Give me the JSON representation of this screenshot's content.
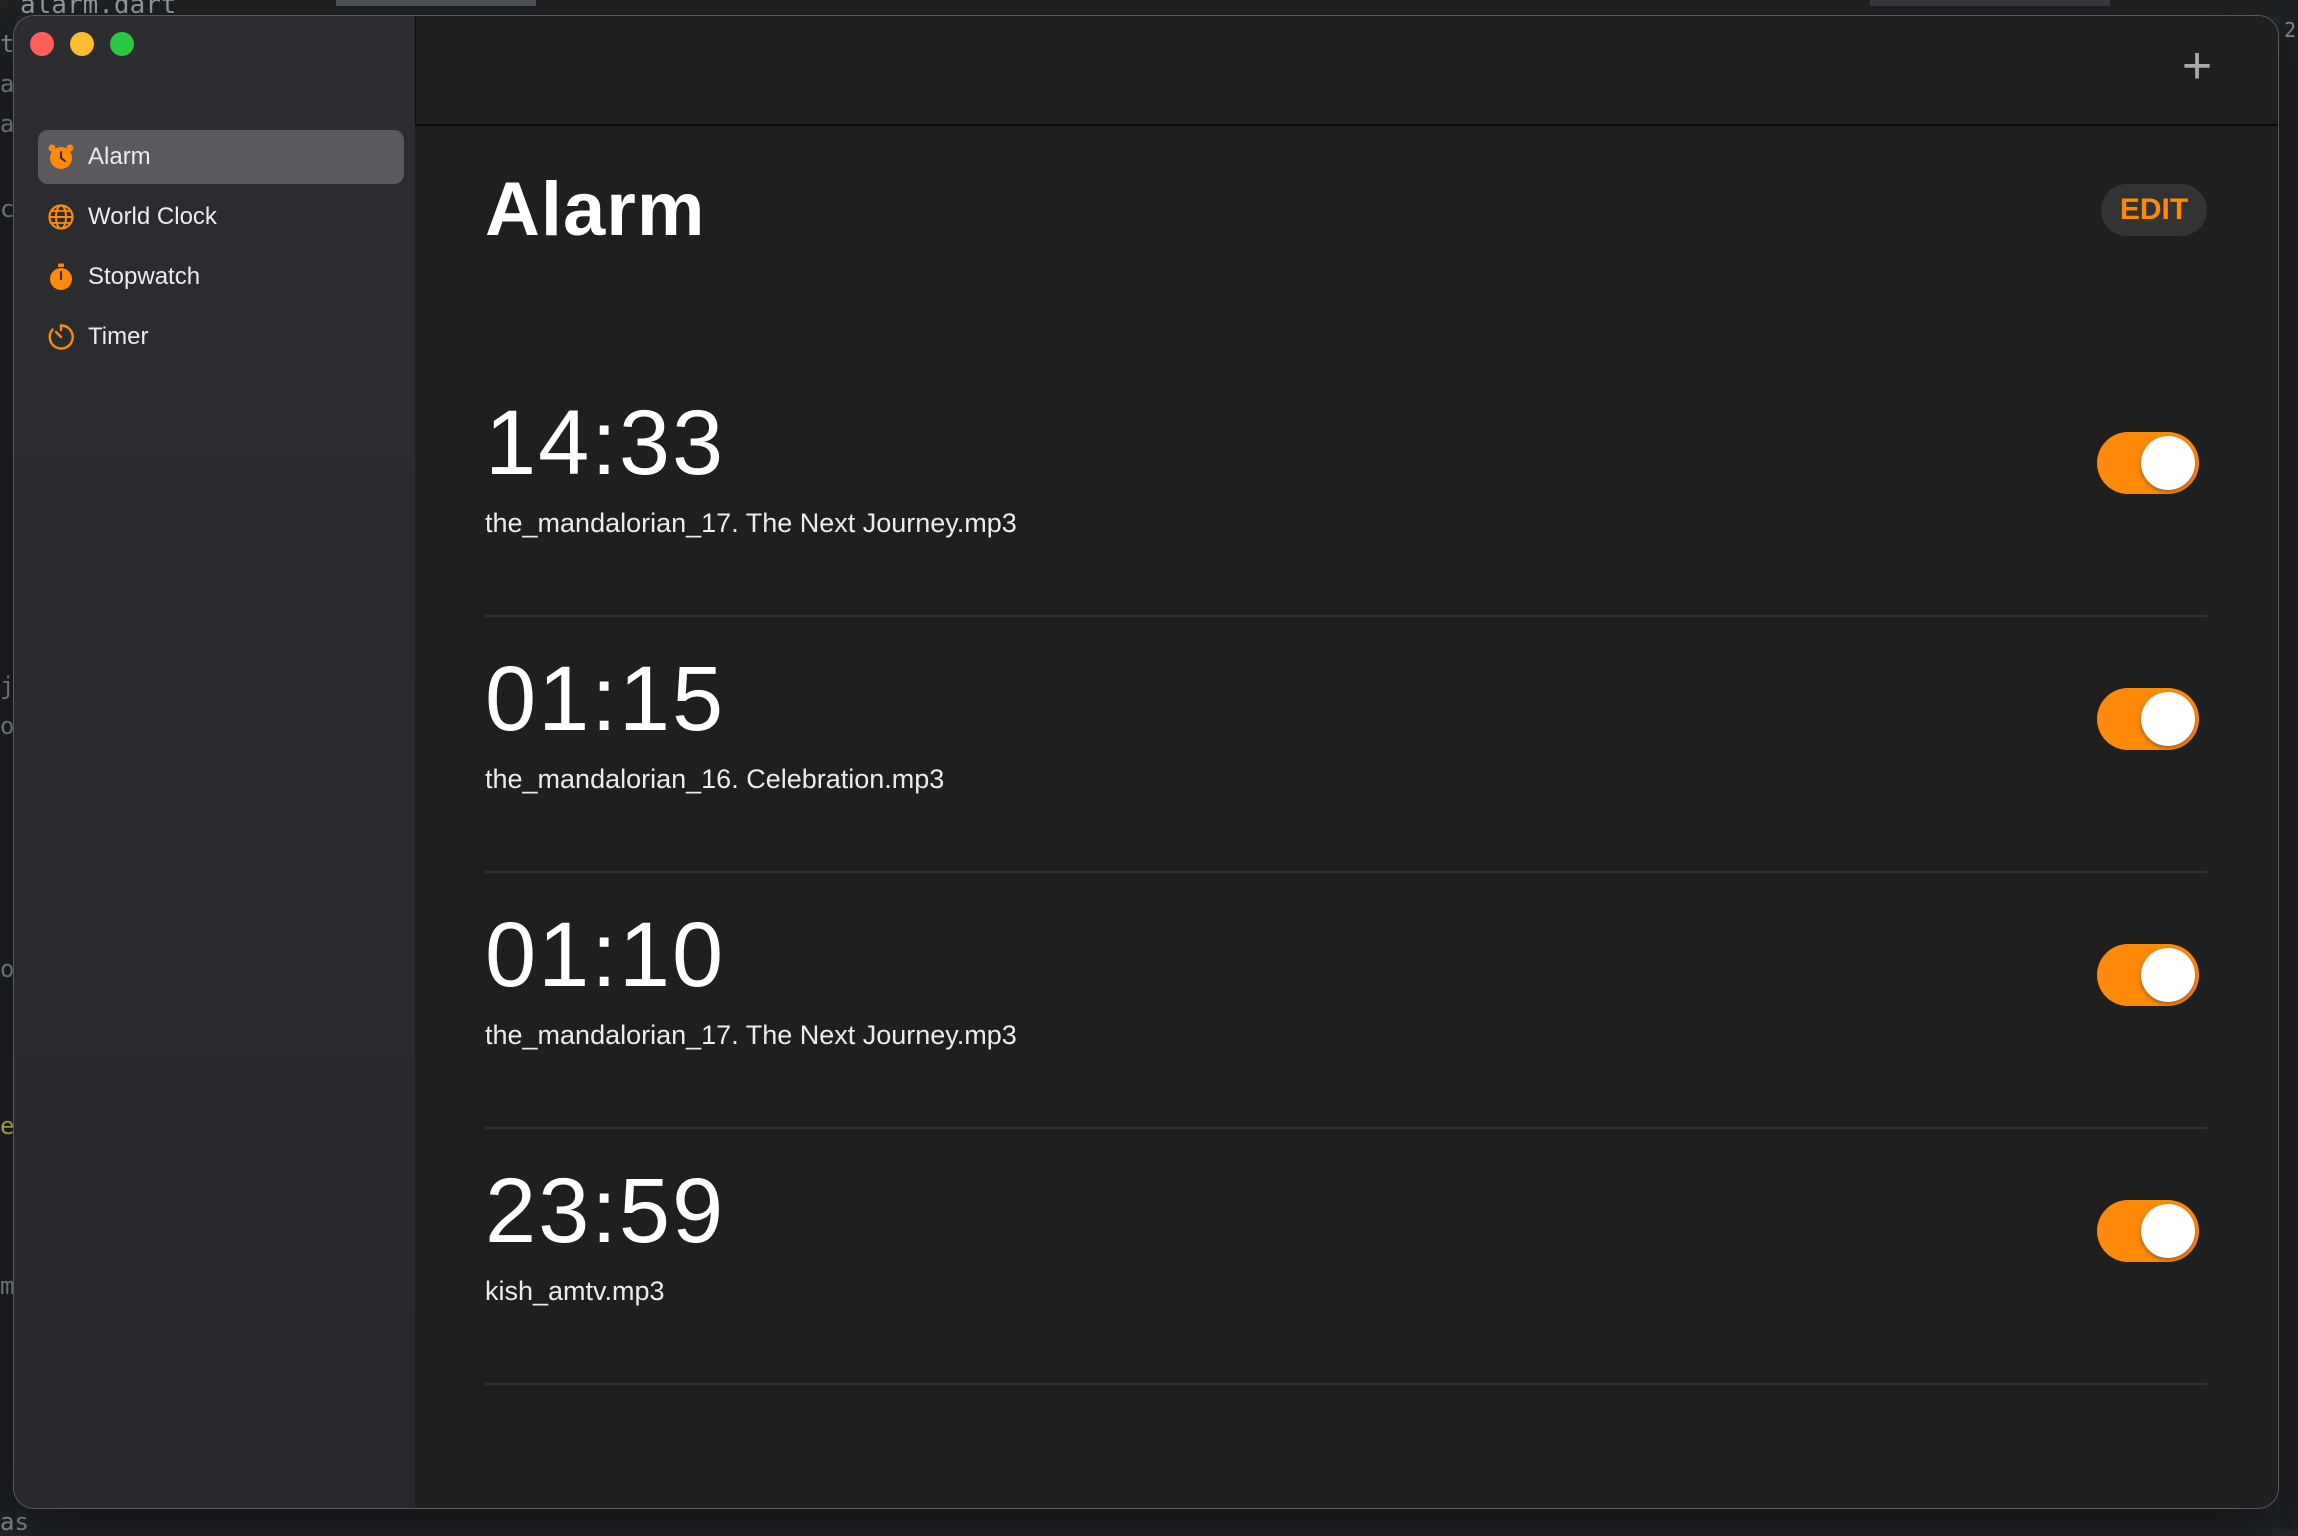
{
  "background_editor": {
    "title_fragment": "alarm.dart",
    "glyphs": [
      "t.",
      "at",
      "at",
      "c",
      "j",
      "oa",
      "or",
      "e",
      "m",
      "as"
    ],
    "right_number": "2"
  },
  "window": {
    "controls": [
      "close",
      "minimize",
      "zoom"
    ]
  },
  "sidebar": {
    "items": [
      {
        "label": "Alarm",
        "icon": "alarm-clock-icon",
        "active": true
      },
      {
        "label": "World Clock",
        "icon": "globe-icon",
        "active": false
      },
      {
        "label": "Stopwatch",
        "icon": "stopwatch-icon",
        "active": false
      },
      {
        "label": "Timer",
        "icon": "timer-icon",
        "active": false
      }
    ]
  },
  "toolbar": {
    "add_label": "+"
  },
  "main": {
    "title": "Alarm",
    "edit_label": "EDIT",
    "alarms": [
      {
        "time": "14:33",
        "sound": "the_mandalorian_17. The Next Journey.mp3",
        "enabled": true
      },
      {
        "time": "01:15",
        "sound": "the_mandalorian_16. Celebration.mp3",
        "enabled": true
      },
      {
        "time": "01:10",
        "sound": "the_mandalorian_17. The Next Journey.mp3",
        "enabled": true
      },
      {
        "time": "23:59",
        "sound": "kish_amtv.mp3",
        "enabled": true
      }
    ]
  },
  "colors": {
    "accent": "#ff8a0a",
    "sidebar_active": "#5a5a5e",
    "background": "#1f1f1f",
    "divider": "#333333",
    "close": "#ff5f57",
    "minimize": "#febc2e",
    "zoom": "#28c840"
  }
}
